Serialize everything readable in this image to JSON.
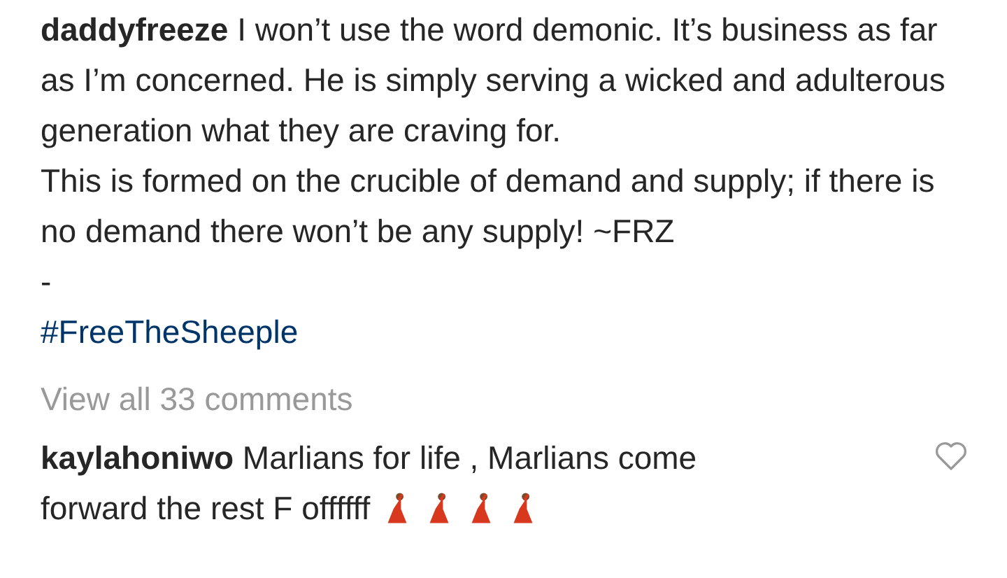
{
  "caption": {
    "paragraphs": [
      "**daddyfreeze** I won’t use the word demonic. It’s business as far as I’m concerned. He is simply serving a wicked and adulterous generation what they are craving for.",
      "This is formed on the crucible of demand and supply; if there is no demand there won’t be any supply! ~FRZ",
      "-"
    ],
    "hashtag": "#FreeTheSheeple"
  },
  "view_all": "View all 33 comments",
  "comments": [
    {
      "lines": [
        "**kaylahoniwo** Marlians for life , Marlians come",
        "forward the rest F offffff"
      ],
      "liked": false
    }
  ]
}
